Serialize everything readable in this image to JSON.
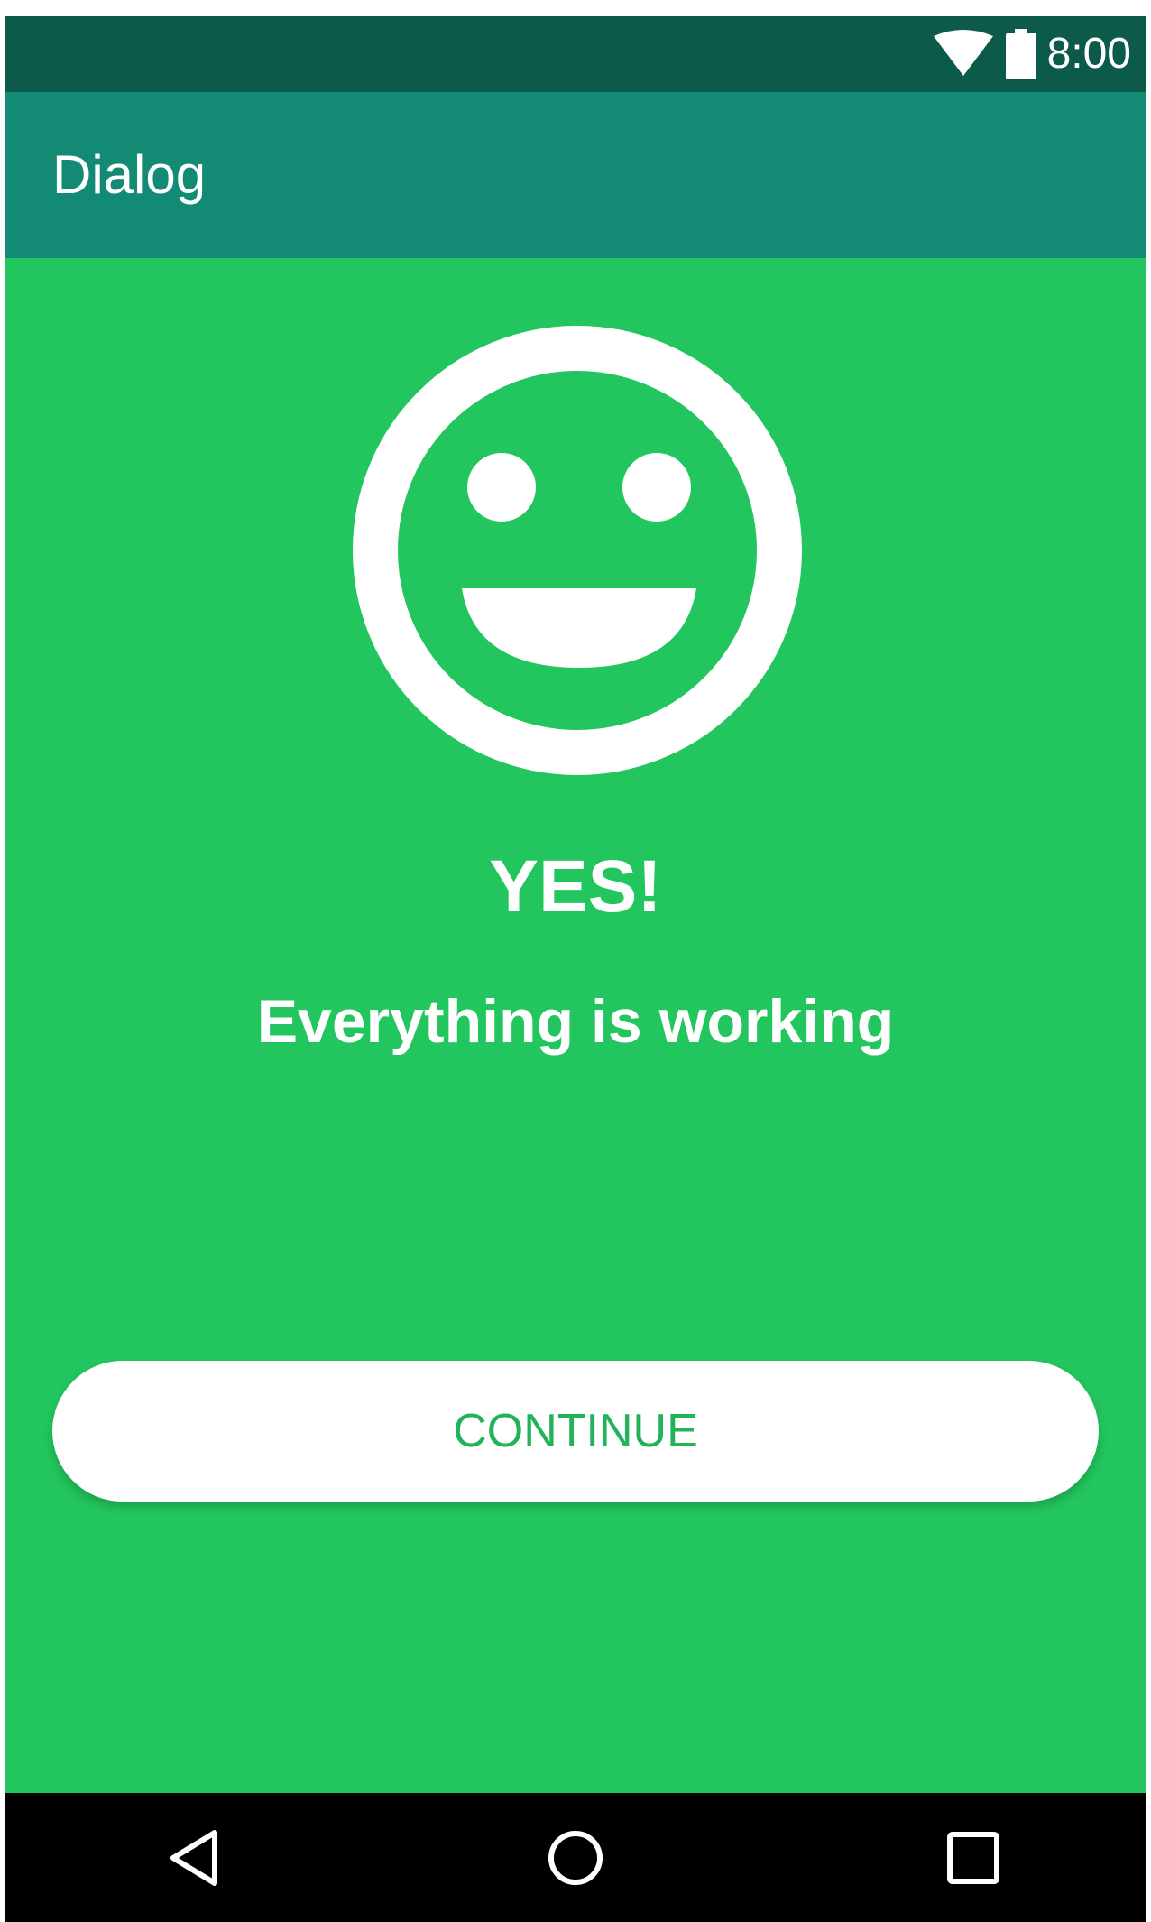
{
  "status_bar": {
    "time": "8:00",
    "icons": [
      "wifi-icon",
      "battery-icon"
    ]
  },
  "app_bar": {
    "title": "Dialog",
    "color": "#128a74"
  },
  "dialog": {
    "icon": "smiley-face-icon",
    "headline": "YES!",
    "message": "Everything is working",
    "button_label": "CONTINUE",
    "background_color": "#22c55e",
    "button_text_color": "#22b35a"
  },
  "nav_bar": {
    "buttons": [
      "back-icon",
      "home-icon",
      "recents-icon"
    ]
  }
}
